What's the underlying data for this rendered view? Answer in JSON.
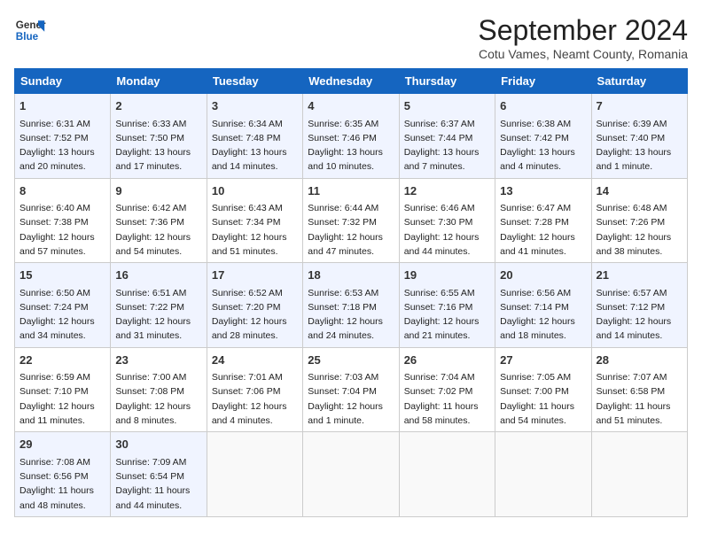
{
  "header": {
    "logo_line1": "General",
    "logo_line2": "Blue",
    "title": "September 2024",
    "subtitle": "Cotu Vames, Neamt County, Romania"
  },
  "columns": [
    "Sunday",
    "Monday",
    "Tuesday",
    "Wednesday",
    "Thursday",
    "Friday",
    "Saturday"
  ],
  "weeks": [
    [
      {
        "day": "1",
        "info": "Sunrise: 6:31 AM\nSunset: 7:52 PM\nDaylight: 13 hours\nand 20 minutes."
      },
      {
        "day": "2",
        "info": "Sunrise: 6:33 AM\nSunset: 7:50 PM\nDaylight: 13 hours\nand 17 minutes."
      },
      {
        "day": "3",
        "info": "Sunrise: 6:34 AM\nSunset: 7:48 PM\nDaylight: 13 hours\nand 14 minutes."
      },
      {
        "day": "4",
        "info": "Sunrise: 6:35 AM\nSunset: 7:46 PM\nDaylight: 13 hours\nand 10 minutes."
      },
      {
        "day": "5",
        "info": "Sunrise: 6:37 AM\nSunset: 7:44 PM\nDaylight: 13 hours\nand 7 minutes."
      },
      {
        "day": "6",
        "info": "Sunrise: 6:38 AM\nSunset: 7:42 PM\nDaylight: 13 hours\nand 4 minutes."
      },
      {
        "day": "7",
        "info": "Sunrise: 6:39 AM\nSunset: 7:40 PM\nDaylight: 13 hours\nand 1 minute."
      }
    ],
    [
      {
        "day": "8",
        "info": "Sunrise: 6:40 AM\nSunset: 7:38 PM\nDaylight: 12 hours\nand 57 minutes."
      },
      {
        "day": "9",
        "info": "Sunrise: 6:42 AM\nSunset: 7:36 PM\nDaylight: 12 hours\nand 54 minutes."
      },
      {
        "day": "10",
        "info": "Sunrise: 6:43 AM\nSunset: 7:34 PM\nDaylight: 12 hours\nand 51 minutes."
      },
      {
        "day": "11",
        "info": "Sunrise: 6:44 AM\nSunset: 7:32 PM\nDaylight: 12 hours\nand 47 minutes."
      },
      {
        "day": "12",
        "info": "Sunrise: 6:46 AM\nSunset: 7:30 PM\nDaylight: 12 hours\nand 44 minutes."
      },
      {
        "day": "13",
        "info": "Sunrise: 6:47 AM\nSunset: 7:28 PM\nDaylight: 12 hours\nand 41 minutes."
      },
      {
        "day": "14",
        "info": "Sunrise: 6:48 AM\nSunset: 7:26 PM\nDaylight: 12 hours\nand 38 minutes."
      }
    ],
    [
      {
        "day": "15",
        "info": "Sunrise: 6:50 AM\nSunset: 7:24 PM\nDaylight: 12 hours\nand 34 minutes."
      },
      {
        "day": "16",
        "info": "Sunrise: 6:51 AM\nSunset: 7:22 PM\nDaylight: 12 hours\nand 31 minutes."
      },
      {
        "day": "17",
        "info": "Sunrise: 6:52 AM\nSunset: 7:20 PM\nDaylight: 12 hours\nand 28 minutes."
      },
      {
        "day": "18",
        "info": "Sunrise: 6:53 AM\nSunset: 7:18 PM\nDaylight: 12 hours\nand 24 minutes."
      },
      {
        "day": "19",
        "info": "Sunrise: 6:55 AM\nSunset: 7:16 PM\nDaylight: 12 hours\nand 21 minutes."
      },
      {
        "day": "20",
        "info": "Sunrise: 6:56 AM\nSunset: 7:14 PM\nDaylight: 12 hours\nand 18 minutes."
      },
      {
        "day": "21",
        "info": "Sunrise: 6:57 AM\nSunset: 7:12 PM\nDaylight: 12 hours\nand 14 minutes."
      }
    ],
    [
      {
        "day": "22",
        "info": "Sunrise: 6:59 AM\nSunset: 7:10 PM\nDaylight: 12 hours\nand 11 minutes."
      },
      {
        "day": "23",
        "info": "Sunrise: 7:00 AM\nSunset: 7:08 PM\nDaylight: 12 hours\nand 8 minutes."
      },
      {
        "day": "24",
        "info": "Sunrise: 7:01 AM\nSunset: 7:06 PM\nDaylight: 12 hours\nand 4 minutes."
      },
      {
        "day": "25",
        "info": "Sunrise: 7:03 AM\nSunset: 7:04 PM\nDaylight: 12 hours\nand 1 minute."
      },
      {
        "day": "26",
        "info": "Sunrise: 7:04 AM\nSunset: 7:02 PM\nDaylight: 11 hours\nand 58 minutes."
      },
      {
        "day": "27",
        "info": "Sunrise: 7:05 AM\nSunset: 7:00 PM\nDaylight: 11 hours\nand 54 minutes."
      },
      {
        "day": "28",
        "info": "Sunrise: 7:07 AM\nSunset: 6:58 PM\nDaylight: 11 hours\nand 51 minutes."
      }
    ],
    [
      {
        "day": "29",
        "info": "Sunrise: 7:08 AM\nSunset: 6:56 PM\nDaylight: 11 hours\nand 48 minutes."
      },
      {
        "day": "30",
        "info": "Sunrise: 7:09 AM\nSunset: 6:54 PM\nDaylight: 11 hours\nand 44 minutes."
      },
      {
        "day": "",
        "info": ""
      },
      {
        "day": "",
        "info": ""
      },
      {
        "day": "",
        "info": ""
      },
      {
        "day": "",
        "info": ""
      },
      {
        "day": "",
        "info": ""
      }
    ]
  ]
}
